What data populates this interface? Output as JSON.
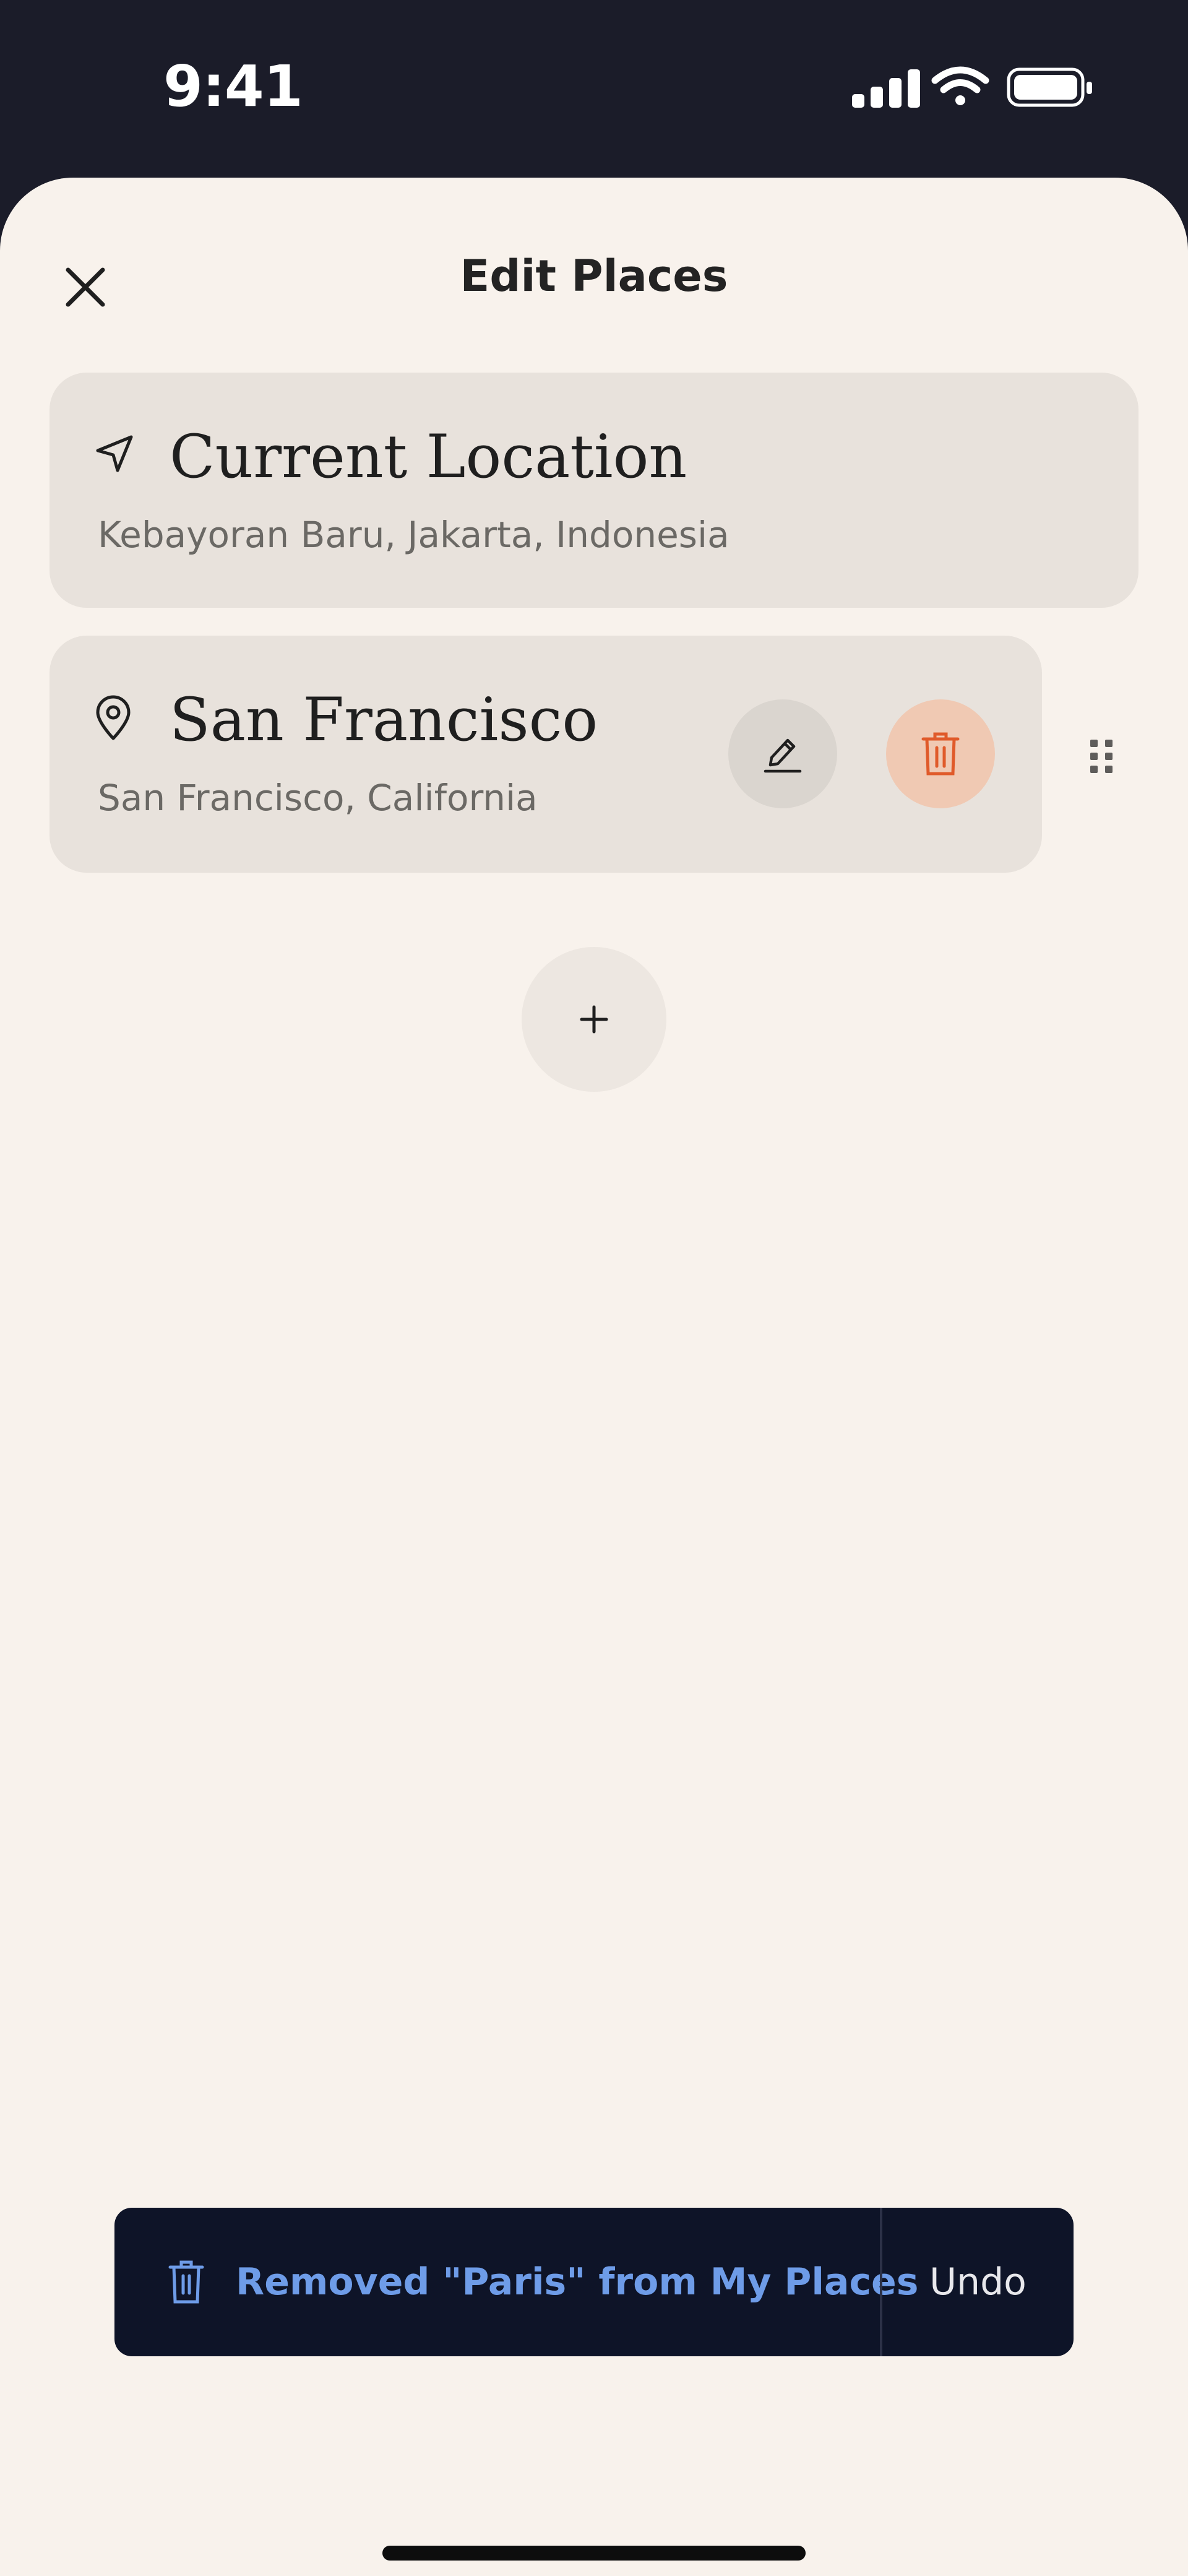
{
  "status_bar": {
    "time": "9:41"
  },
  "header": {
    "title": "Edit Places"
  },
  "places": [
    {
      "name": "Current Location",
      "subtitle": "Kebayoran Baru, Jakarta, Indonesia",
      "icon": "navigation-arrow-icon"
    },
    {
      "name": "San Francisco",
      "subtitle": "San Francisco, California",
      "icon": "map-pin-icon"
    }
  ],
  "toast": {
    "message": "Removed \"Paris\" from My Places",
    "action_label": "Undo",
    "icon": "trash-icon"
  },
  "colors": {
    "background": "#f8f2ec",
    "card": "#e8e2dc",
    "delete_accent": "#e05a2a",
    "toast_bg": "#0e1428",
    "toast_text": "#6e9ce8"
  }
}
